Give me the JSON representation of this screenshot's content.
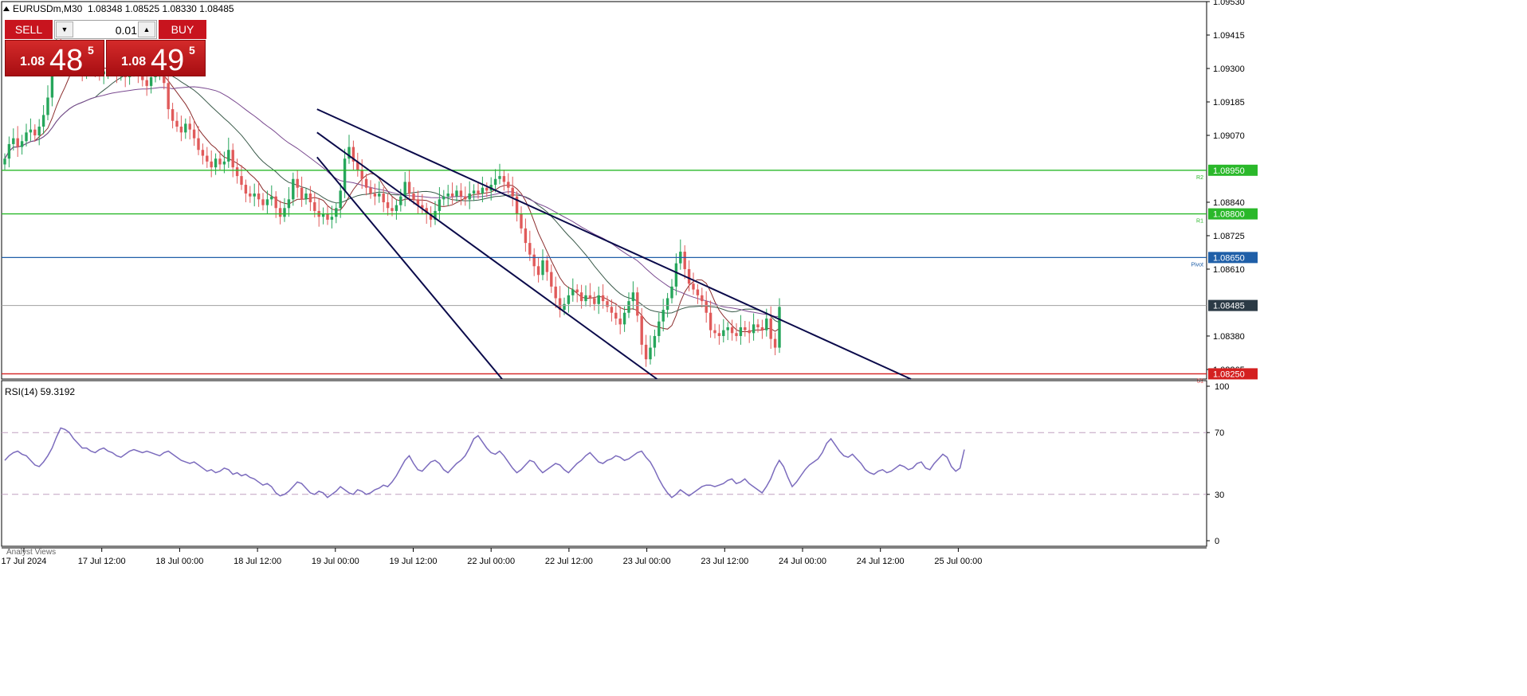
{
  "header": {
    "symbol": "EURUSDm,M30",
    "ohlc": "1.08348 1.08525 1.08330 1.08485"
  },
  "trade_panel": {
    "sell_label": "SELL",
    "buy_label": "BUY",
    "lot_value": "0.01",
    "sell_price": {
      "prefix": "1.08",
      "big": "48",
      "sup": "5"
    },
    "buy_price": {
      "prefix": "1.08",
      "big": "49",
      "sup": "5"
    }
  },
  "rsi": {
    "label": "RSI(14) 59.3192",
    "ticks": [
      "100",
      "70",
      "30",
      "0"
    ],
    "levels": [
      70,
      30
    ]
  },
  "footer": {
    "analyst_label": "Analyst Views"
  },
  "colors": {
    "bull": "#26a65b",
    "bear": "#e05a5a",
    "resistance": "#2ab82a",
    "pivot": "#1f5fa8",
    "support": "#d42020",
    "channel": "#0a0a4a",
    "rsi_line": "#7b6bbd",
    "current_price_tag": "#2b3a45"
  },
  "chart_data": {
    "type": "line",
    "symbol": "EURUSDm",
    "timeframe": "M30",
    "y_ticks": [
      "1.09530",
      "1.09415",
      "1.09300",
      "1.09185",
      "1.09070",
      "1.08840",
      "1.08725",
      "1.08610",
      "1.08380",
      "1.08265"
    ],
    "x_ticks": [
      "17 Jul 2024",
      "17 Jul 12:00",
      "18 Jul 00:00",
      "18 Jul 12:00",
      "19 Jul 00:00",
      "19 Jul 12:00",
      "22 Jul 00:00",
      "22 Jul 12:00",
      "23 Jul 00:00",
      "23 Jul 12:00",
      "24 Jul 00:00",
      "24 Jul 12:00",
      "25 Jul 00:00"
    ],
    "ylim": [
      1.08232,
      1.0953
    ],
    "current_price": "1.08485",
    "levels": [
      {
        "price": "1.08950",
        "label": "R2",
        "color_key": "resistance"
      },
      {
        "price": "1.08800",
        "label": "R1",
        "color_key": "resistance"
      },
      {
        "price": "1.08650",
        "label": "Pivot",
        "color_key": "pivot"
      },
      {
        "price": "1.08250",
        "label": "S1",
        "color_key": "support"
      }
    ],
    "close_series": [
      1.0899,
      1.0904,
      1.0906,
      1.0903,
      1.0905,
      1.0908,
      1.0909,
      1.0907,
      1.091,
      1.0914,
      1.092,
      1.093,
      1.0938,
      1.0936,
      1.0934,
      1.0935,
      1.0932,
      1.093,
      1.0929,
      1.0931,
      1.0932,
      1.093,
      1.0928,
      1.0929,
      1.0931,
      1.093,
      1.0928,
      1.0929,
      1.0927,
      1.0929,
      1.093,
      1.0928,
      1.0926,
      1.0924,
      1.0927,
      1.0929,
      1.0931,
      1.0925,
      1.0916,
      1.0912,
      1.091,
      1.0908,
      1.0911,
      1.0909,
      1.0906,
      1.0902,
      1.09,
      1.0898,
      1.0896,
      1.0899,
      1.0897,
      1.0898,
      1.0902,
      1.0896,
      1.0893,
      1.089,
      1.0887,
      1.0886,
      1.0887,
      1.0885,
      1.0883,
      1.0885,
      1.0886,
      1.0882,
      1.0879,
      1.0882,
      1.0885,
      1.0892,
      1.0889,
      1.0885,
      1.0887,
      1.0884,
      1.0881,
      1.0879,
      1.088,
      1.0878,
      1.0879,
      1.0882,
      1.0888,
      1.0899,
      1.0903,
      1.0898,
      1.0895,
      1.0892,
      1.0889,
      1.0887,
      1.0886,
      1.0887,
      1.0884,
      1.0882,
      1.0881,
      1.0883,
      1.0886,
      1.0891,
      1.0887,
      1.0885,
      1.0883,
      1.0882,
      1.088,
      1.0878,
      1.0881,
      1.0885,
      1.0886,
      1.0887,
      1.0886,
      1.0888,
      1.0886,
      1.0885,
      1.0887,
      1.0888,
      1.0887,
      1.0889,
      1.0888,
      1.089,
      1.0892,
      1.0893,
      1.0891,
      1.0889,
      1.0886,
      1.088,
      1.0875,
      1.087,
      1.0866,
      1.0862,
      1.0859,
      1.0864,
      1.086,
      1.0855,
      1.0851,
      1.0847,
      1.0849,
      1.0852,
      1.0854,
      1.0853,
      1.085,
      1.0852,
      1.0851,
      1.0849,
      1.0852,
      1.085,
      1.0848,
      1.0846,
      1.0844,
      1.0842,
      1.0846,
      1.085,
      1.0853,
      1.0845,
      1.0835,
      1.083,
      1.0834,
      1.0838,
      1.0843,
      1.0847,
      1.0851,
      1.0855,
      1.0863,
      1.0867,
      1.0861,
      1.0856,
      1.0854,
      1.0852,
      1.085,
      1.0846,
      1.084,
      1.0839,
      1.0838,
      1.084,
      1.0841,
      1.0839,
      1.0838,
      1.0841,
      1.084,
      1.0839,
      1.0842,
      1.0841,
      1.084,
      1.0844,
      1.0837,
      1.0834,
      1.0848
    ],
    "rsi_series": [
      52,
      55,
      57,
      58,
      56,
      55,
      52,
      49,
      48,
      51,
      55,
      60,
      67,
      73,
      72,
      70,
      66,
      63,
      60,
      60,
      58,
      57,
      59,
      60,
      58,
      57,
      55,
      54,
      56,
      58,
      59,
      58,
      57,
      58,
      57,
      56,
      55,
      57,
      58,
      56,
      54,
      52,
      51,
      50,
      51,
      49,
      47,
      45,
      46,
      44,
      45,
      47,
      46,
      43,
      44,
      42,
      43,
      41,
      40,
      38,
      36,
      37,
      35,
      31,
      29,
      30,
      32,
      35,
      38,
      37,
      34,
      31,
      30,
      32,
      31,
      28,
      30,
      32,
      35,
      33,
      31,
      30,
      33,
      32,
      30,
      31,
      33,
      34,
      36,
      35,
      38,
      42,
      47,
      52,
      55,
      50,
      46,
      45,
      48,
      51,
      52,
      50,
      46,
      44,
      47,
      50,
      52,
      55,
      60,
      66,
      68,
      64,
      60,
      57,
      56,
      58,
      55,
      51,
      47,
      44,
      46,
      49,
      52,
      51,
      47,
      44,
      46,
      48,
      50,
      49,
      46,
      44,
      47,
      50,
      52,
      55,
      57,
      54,
      51,
      50,
      52,
      53,
      55,
      54,
      52,
      53,
      55,
      57,
      58,
      54,
      51,
      46,
      40,
      35,
      31,
      28,
      30,
      33,
      31,
      29,
      31,
      33,
      35,
      36,
      36,
      35,
      36,
      37,
      39,
      40,
      37,
      38,
      40,
      37,
      35,
      33,
      31,
      35,
      40,
      47,
      52,
      48,
      41,
      35,
      38,
      42,
      46,
      49,
      51,
      53,
      57,
      63,
      66,
      62,
      58,
      55,
      54,
      56,
      53,
      50,
      46,
      44,
      43,
      45,
      46,
      44,
      45,
      47,
      49,
      48,
      46,
      47,
      50,
      51,
      47,
      46,
      50,
      53,
      56,
      54,
      48,
      45,
      47,
      59
    ],
    "channel_lines": [
      {
        "x1": 17,
        "y1": 1.08995,
        "x2": 60,
        "y2": 1.08232
      },
      {
        "x1": 17,
        "y1": 1.0908,
        "x2": 96,
        "y2": 1.08232
      },
      {
        "x1": 17,
        "y1": 1.0916,
        "x2": 155,
        "y2": 1.08232
      }
    ]
  }
}
